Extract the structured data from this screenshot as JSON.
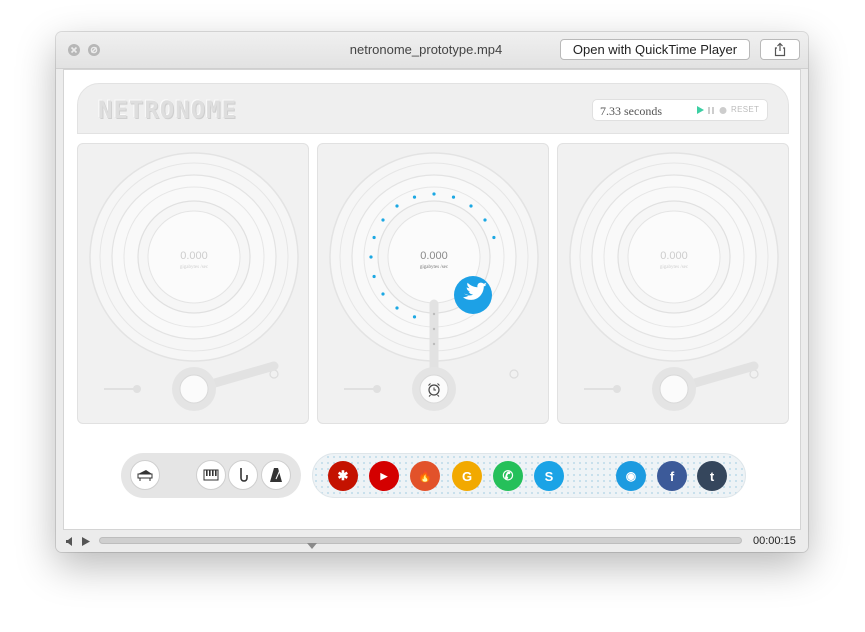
{
  "window": {
    "title": "netronome_prototype.mp4",
    "open_with_label": "Open with QuickTime Player",
    "close_icon": "close-icon",
    "minimize_icon": "minimize-icon",
    "share_icon": "share-icon"
  },
  "app": {
    "logo": "NETRONOME",
    "timer": {
      "value": "7.33 seconds",
      "reset_label": "RESET",
      "play_icon": "play-icon",
      "pause_icon": "pause-icon",
      "stop_icon": "stop-icon",
      "accent": "#3ccfa3"
    },
    "decks": [
      {
        "value": "0.000",
        "unit": "gigabytes /sec",
        "active": false
      },
      {
        "value": "0.000",
        "unit": "gigabytes /sec",
        "active": true,
        "badge_icon": "twitter-icon",
        "knob_icon": "alarm-clock-icon"
      },
      {
        "value": "0.000",
        "unit": "gigabytes /sec",
        "active": false
      }
    ],
    "instruments": [
      {
        "name": "piano-icon"
      },
      {
        "name": "keyboard-icon"
      },
      {
        "name": "saxophone-icon"
      },
      {
        "name": "metronome-icon"
      }
    ],
    "social": [
      {
        "name": "yelp-icon",
        "glyph": "✱",
        "color": "#c41200"
      },
      {
        "name": "youtube-icon",
        "glyph": "▶",
        "color": "#d40000"
      },
      {
        "name": "tinder-icon",
        "glyph": "🔥",
        "color": "#e2522a"
      },
      {
        "name": "google-icon",
        "glyph": "G",
        "color": "#f2a900"
      },
      {
        "name": "whatsapp-icon",
        "glyph": "✆",
        "color": "#25c05a"
      },
      {
        "name": "skype-icon",
        "glyph": "S",
        "color": "#1aa3e6"
      },
      {
        "name": "reddit-icon",
        "glyph": "◉",
        "color": "#1c9be0"
      },
      {
        "name": "facebook-icon",
        "glyph": "f",
        "color": "#3c5a99"
      },
      {
        "name": "tumblr-icon",
        "glyph": "t",
        "color": "#35465c"
      }
    ]
  },
  "player": {
    "playback_fraction": 0.33,
    "time": "00:00:15",
    "volume_icon": "volume-icon",
    "play_icon": "play-icon"
  }
}
